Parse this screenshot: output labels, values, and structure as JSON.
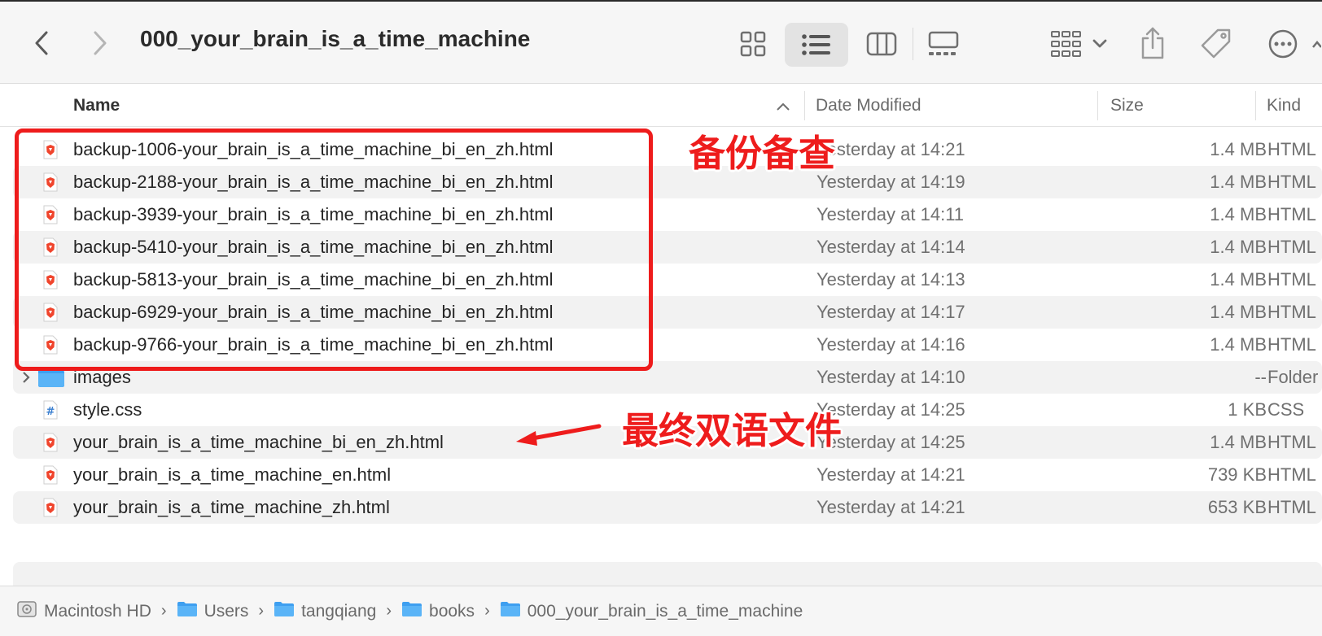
{
  "toolbar": {
    "title": "000_your_brain_is_a_time_machine",
    "icons": [
      "back-chevron-icon",
      "forward-chevron-icon",
      "icon-view-icon",
      "list-view-icon",
      "column-view-icon",
      "gallery-view-icon",
      "group-by-icon",
      "share-icon",
      "tag-icon",
      "more-icon"
    ]
  },
  "columns": {
    "name": "Name",
    "date": "Date Modified",
    "size": "Size",
    "kind": "Kind"
  },
  "files": [
    {
      "name": "backup-1006-your_brain_is_a_time_machine_bi_en_zh.html",
      "date": "Yesterday at 14:21",
      "size": "1.4 MB",
      "kind": "HTML",
      "icon": "brave-html-icon"
    },
    {
      "name": "backup-2188-your_brain_is_a_time_machine_bi_en_zh.html",
      "date": "Yesterday at 14:19",
      "size": "1.4 MB",
      "kind": "HTML",
      "icon": "brave-html-icon"
    },
    {
      "name": "backup-3939-your_brain_is_a_time_machine_bi_en_zh.html",
      "date": "Yesterday at 14:11",
      "size": "1.4 MB",
      "kind": "HTML",
      "icon": "brave-html-icon"
    },
    {
      "name": "backup-5410-your_brain_is_a_time_machine_bi_en_zh.html",
      "date": "Yesterday at 14:14",
      "size": "1.4 MB",
      "kind": "HTML",
      "icon": "brave-html-icon"
    },
    {
      "name": "backup-5813-your_brain_is_a_time_machine_bi_en_zh.html",
      "date": "Yesterday at 14:13",
      "size": "1.4 MB",
      "kind": "HTML",
      "icon": "brave-html-icon"
    },
    {
      "name": "backup-6929-your_brain_is_a_time_machine_bi_en_zh.html",
      "date": "Yesterday at 14:17",
      "size": "1.4 MB",
      "kind": "HTML",
      "icon": "brave-html-icon"
    },
    {
      "name": "backup-9766-your_brain_is_a_time_machine_bi_en_zh.html",
      "date": "Yesterday at 14:16",
      "size": "1.4 MB",
      "kind": "HTML",
      "icon": "brave-html-icon"
    },
    {
      "name": "images",
      "date": "Yesterday at 14:10",
      "size": "--",
      "kind": "Folder",
      "icon": "folder-icon"
    },
    {
      "name": "style.css",
      "date": "Yesterday at 14:25",
      "size": "1 KB",
      "kind": "CSS",
      "icon": "css-file-icon"
    },
    {
      "name": "your_brain_is_a_time_machine_bi_en_zh.html",
      "date": "Yesterday at 14:25",
      "size": "1.4 MB",
      "kind": "HTML",
      "icon": "brave-html-icon"
    },
    {
      "name": "your_brain_is_a_time_machine_en.html",
      "date": "Yesterday at 14:21",
      "size": "739 KB",
      "kind": "HTML",
      "icon": "brave-html-icon"
    },
    {
      "name": "your_brain_is_a_time_machine_zh.html",
      "date": "Yesterday at 14:21",
      "size": "653 KB",
      "kind": "HTML",
      "icon": "brave-html-icon"
    }
  ],
  "annotations": {
    "backup_label": "备份备查",
    "final_label": "最终双语文件",
    "color": "#ee1c1c"
  },
  "pathbar": [
    "Macintosh HD",
    "Users",
    "tangqiang",
    "books",
    "000_your_brain_is_a_time_machine"
  ]
}
